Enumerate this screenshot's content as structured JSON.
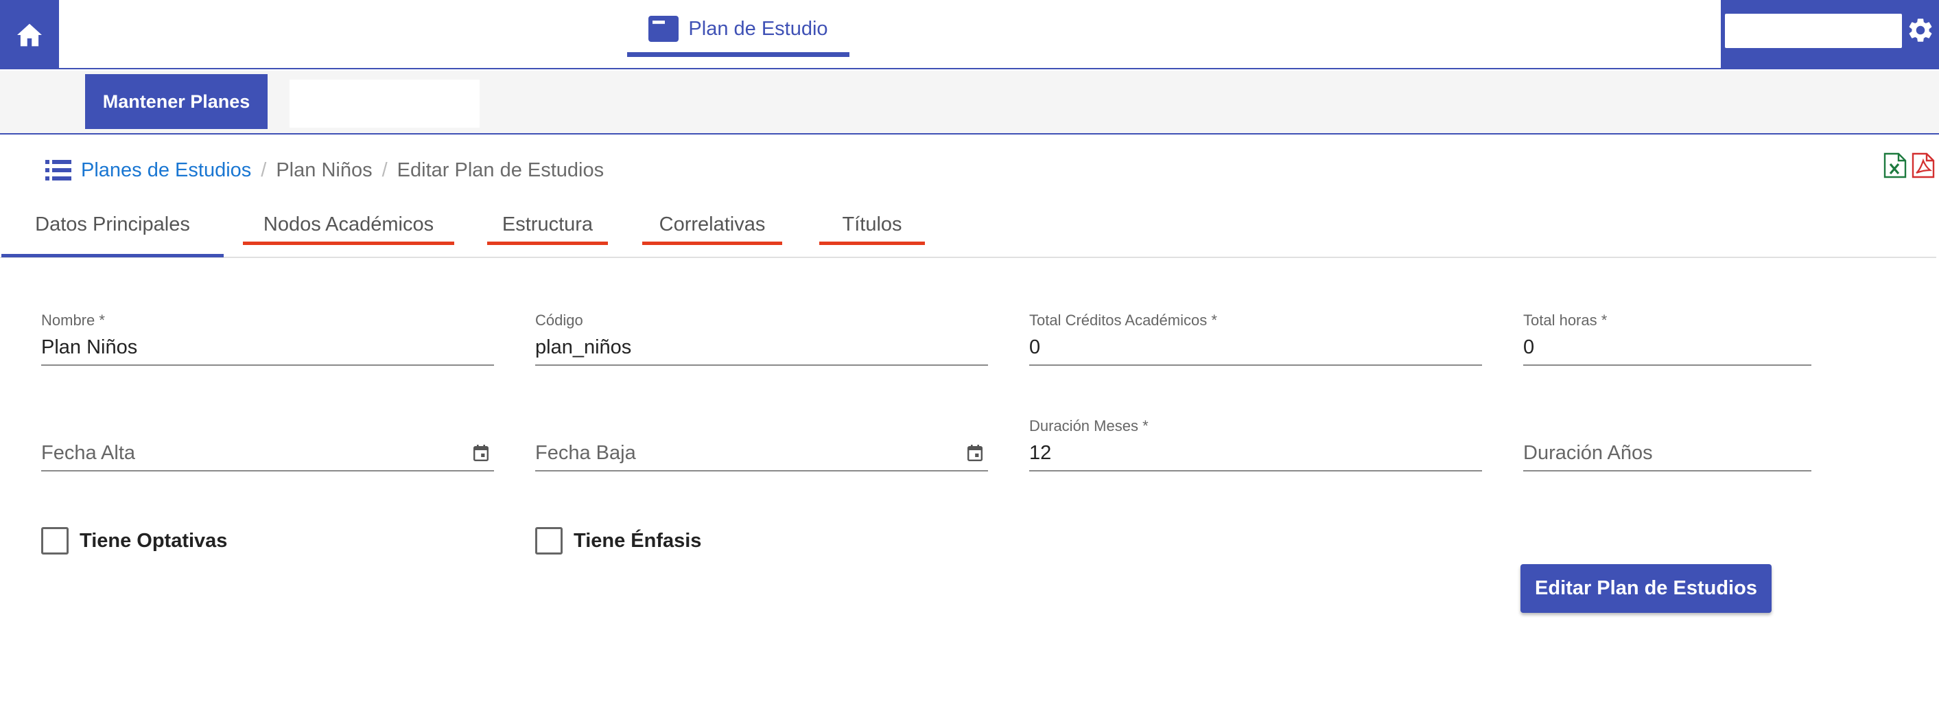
{
  "header": {
    "home_icon": "home-icon",
    "title": "Plan de Estudio",
    "title_icon": "document-icon",
    "search_value": "",
    "gear_icon": "gear-icon"
  },
  "subbar": {
    "button_label": "Mantener Planes",
    "blank_value": ""
  },
  "breadcrumb": {
    "icon": "list-icon",
    "items": [
      "Planes de Estudios",
      "Plan Niños",
      "Editar Plan de Estudios"
    ],
    "separator": "/"
  },
  "export": {
    "excel_icon": "excel-icon",
    "pdf_icon": "pdf-icon"
  },
  "tabs": {
    "items": [
      "Datos Principales",
      "Nodos Académicos",
      "Estructura",
      "Correlativas",
      "Títulos"
    ],
    "active": "Datos Principales",
    "with_errors": [
      "Nodos Académicos",
      "Estructura",
      "Correlativas",
      "Títulos"
    ]
  },
  "form": {
    "nombre": {
      "label": "Nombre *",
      "value": "Plan Niños"
    },
    "codigo": {
      "label": "Código",
      "value": "plan_niños"
    },
    "creditos": {
      "label": "Total Créditos Académicos *",
      "value": "0"
    },
    "horas": {
      "label": "Total horas *",
      "value": "0"
    },
    "fecha_alta": {
      "placeholder": "Fecha Alta"
    },
    "fecha_baja": {
      "placeholder": "Fecha Baja"
    },
    "duracion_meses": {
      "label": "Duración Meses *",
      "value": "12"
    },
    "duracion_anios": {
      "placeholder": "Duración Años"
    },
    "optativas": {
      "label": "Tiene Optativas",
      "checked": false
    },
    "enfasis": {
      "label": "Tiene Énfasis",
      "checked": false
    }
  },
  "actions": {
    "submit_label": "Editar Plan de Estudios"
  },
  "colors": {
    "primary": "#3f51b5",
    "error": "#e53c1d",
    "link": "#1976d2",
    "excel": "#1d7a3e",
    "pdf": "#d32f2f"
  }
}
